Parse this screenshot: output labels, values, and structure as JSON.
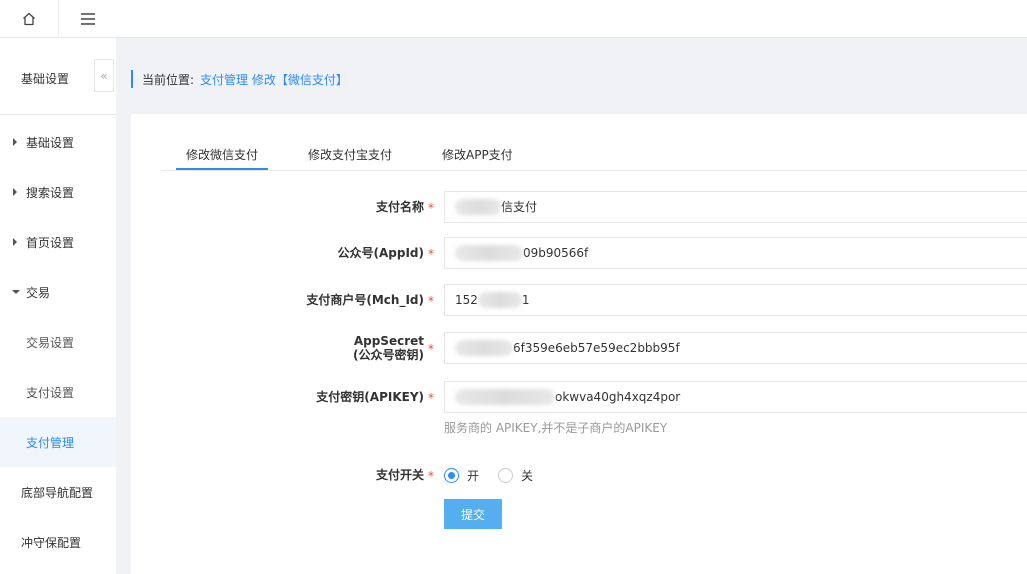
{
  "sidebar": {
    "title": "基础设置",
    "items": [
      {
        "label": "基础设置",
        "expanded": false
      },
      {
        "label": "搜索设置",
        "expanded": false
      },
      {
        "label": "首页设置",
        "expanded": false
      },
      {
        "label": "交易",
        "expanded": true
      }
    ],
    "sub_items": [
      {
        "label": "交易设置"
      },
      {
        "label": "支付设置"
      },
      {
        "label": "支付管理",
        "active": true
      }
    ],
    "plain_items": [
      {
        "label": "底部导航配置"
      },
      {
        "label": "冲守保配置"
      }
    ]
  },
  "breadcrumb": {
    "prefix": "当前位置:",
    "path": "支付管理 修改【微信支付】"
  },
  "tabs": [
    {
      "label": "修改微信支付",
      "active": true
    },
    {
      "label": "修改支付宝支付",
      "active": false
    },
    {
      "label": "修改APP支付",
      "active": false
    }
  ],
  "form": {
    "name": {
      "label": "支付名称",
      "value_suffix": "信支付"
    },
    "appid": {
      "label": "公众号(AppId)",
      "value_suffix": "09b90566f"
    },
    "mch_id": {
      "label": "支付商户号(Mch_Id)",
      "value_prefix": "152",
      "value_suffix": "1"
    },
    "appsecret": {
      "label_line1": "AppSecret",
      "label_line2": "(公众号密钥)",
      "value_suffix": "6f359e6eb57e59ec2bbb95f"
    },
    "apikey": {
      "label": "支付密钥(APIKEY)",
      "value_suffix": "okwva40gh4xqz4por",
      "hint": "服务商的 APIKEY,并不是子商户的APIKEY"
    },
    "switch": {
      "label": "支付开关",
      "on_label": "开",
      "off_label": "关",
      "selected": "on"
    },
    "required_mark": "*",
    "submit_label": "提交"
  },
  "colors": {
    "accent": "#2d8cf0",
    "button": "#55aef0",
    "required": "#e74c3c"
  }
}
